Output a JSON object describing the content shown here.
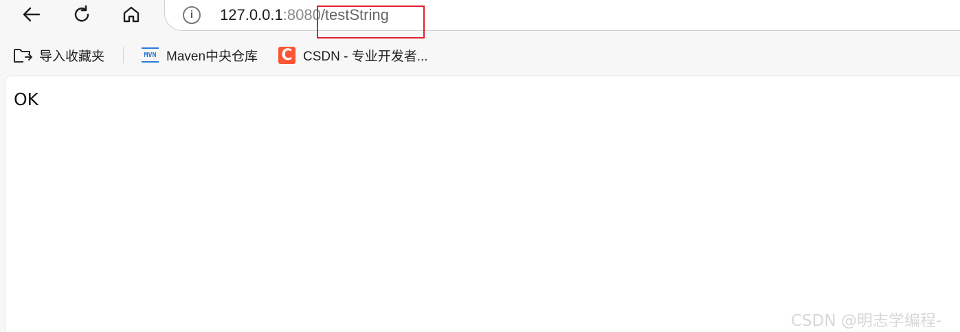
{
  "navigation": {
    "back_icon": "arrow-left-icon",
    "refresh_icon": "refresh-icon",
    "home_icon": "home-icon"
  },
  "address_bar": {
    "info_icon": "info-icon",
    "info_glyph": "i",
    "host": "127.0.0.1",
    "port": ":8080",
    "path": "/testString",
    "highlight_color": "#e61e2b"
  },
  "bookmarks": [
    {
      "label": "导入收藏夹",
      "icon": "folder-import-icon"
    },
    {
      "label": "Maven中央仓库",
      "icon": "maven-icon",
      "icon_text": "MVN"
    },
    {
      "label": "CSDN - 专业开发者...",
      "icon": "csdn-icon",
      "icon_text": "C",
      "color": "#fc5531"
    }
  ],
  "page": {
    "response": "OK"
  },
  "watermark": "CSDN @明志学编程-"
}
